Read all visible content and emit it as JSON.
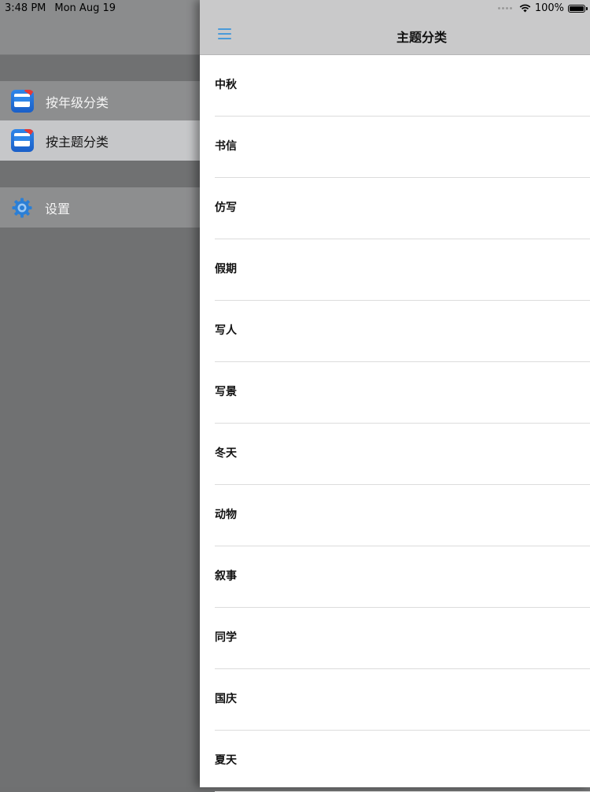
{
  "status_bar": {
    "time": "3:48 PM",
    "date": "Mon Aug 19",
    "battery": "100%",
    "battery_level": 1.0,
    "icons": [
      "signal-dots-icon",
      "wifi-icon",
      "battery-icon"
    ]
  },
  "drawer": {
    "items": [
      {
        "label": "按年级分类",
        "icon": "app-book-icon"
      },
      {
        "label": "按主题分类",
        "icon": "app-book-icon",
        "selected": true
      },
      {
        "label": "设置",
        "icon": "gear-icon"
      }
    ]
  },
  "nav": {
    "title": "主题分类",
    "menu_icon": "hamburger-icon"
  },
  "topics": [
    "中秋",
    "书信",
    "仿写",
    "假期",
    "写人",
    "写景",
    "冬天",
    "动物",
    "叙事",
    "同学",
    "国庆",
    "夏天"
  ],
  "colors": {
    "accent": "#4a9ad9",
    "icon_blue": "#2f86e8",
    "selected_row": "#c6c7c9",
    "navbar": "#c9c9ca"
  }
}
